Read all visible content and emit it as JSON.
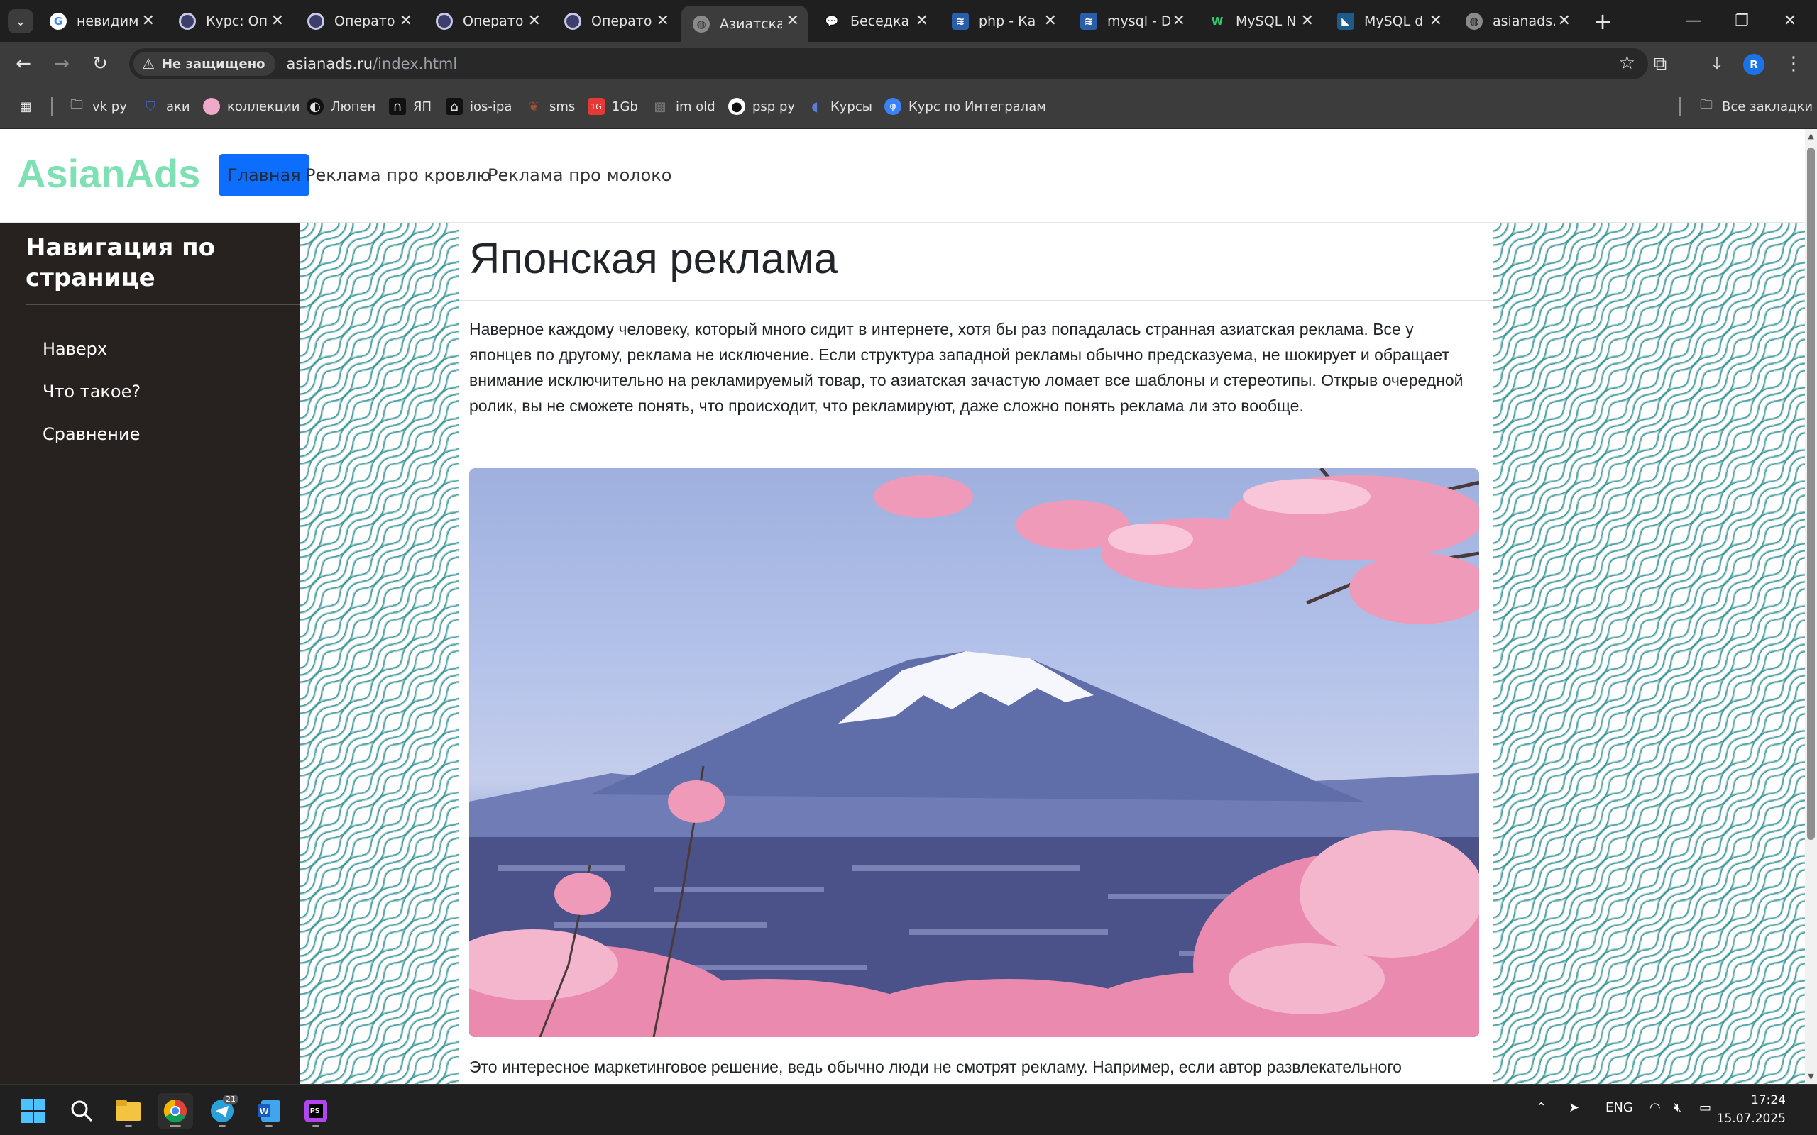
{
  "browser": {
    "tabs": [
      {
        "title": "невидим",
        "favicon": "google-icon",
        "active": false
      },
      {
        "title": "Курс: Опе",
        "favicon": "moodle-icon",
        "active": false
      },
      {
        "title": "Операто",
        "favicon": "moodle-icon",
        "active": false
      },
      {
        "title": "Операто",
        "favicon": "moodle-icon",
        "active": false
      },
      {
        "title": "Операто",
        "favicon": "moodle-icon",
        "active": false
      },
      {
        "title": "Азиатска",
        "favicon": "globe-icon",
        "active": true
      },
      {
        "title": "Беседка",
        "favicon": "chat-icon",
        "active": false
      },
      {
        "title": "php - Ка",
        "favicon": "stackexchange-icon",
        "active": false
      },
      {
        "title": "mysql - D",
        "favicon": "stackexchange-icon",
        "active": false
      },
      {
        "title": "MySQL N",
        "favicon": "w-icon",
        "active": false
      },
      {
        "title": "MySQL d",
        "favicon": "mysql-icon",
        "active": false
      },
      {
        "title": "asianads.",
        "favicon": "globe-icon",
        "active": false
      }
    ],
    "security_label": "Не защищено",
    "url_host": "asianads.ru",
    "url_path": "/index.html",
    "profile_initial": "R",
    "bookmarks": [
      {
        "label": "vk py",
        "icon": "folder-icon"
      },
      {
        "label": "аки",
        "icon": "bag-icon"
      },
      {
        "label": "коллекции",
        "icon": "pink-ball-icon"
      },
      {
        "label": "Люпен",
        "icon": "lupin-icon"
      },
      {
        "label": "ЯП",
        "icon": "arch-icon"
      },
      {
        "label": "ios-ipa",
        "icon": "building-icon"
      },
      {
        "label": "sms",
        "icon": "bird-icon"
      },
      {
        "label": "1Gb",
        "icon": "1gb-icon"
      },
      {
        "label": "im old",
        "icon": "grid-icon"
      },
      {
        "label": "psp py",
        "icon": "github-icon"
      },
      {
        "label": "Курсы",
        "icon": "dot-icon"
      },
      {
        "label": "Курс по Интегралам",
        "icon": "blue-circle-icon"
      }
    ],
    "all_bookmarks": "Все закладки"
  },
  "site": {
    "brand": "AsianAds",
    "nav": [
      {
        "label": "Главная",
        "active": true
      },
      {
        "label": "Реклама про кровлю",
        "active": false
      },
      {
        "label": "Реклама про молоко",
        "active": false
      }
    ],
    "sidebar": {
      "title": "Навигация по странице",
      "links": [
        "Наверх",
        "Что такое?",
        "Сравнение"
      ]
    },
    "heading": "Японская реклама",
    "paragraph": "Наверное каждому человеку, который много сидит в интернете, хотя бы раз попадалась странная азиатская реклама. Все у японцев по другому, реклама не исключение. Если структура западной рекламы обычно предсказуема, не шокирует и обращает внимание исключительно на рекламируемый товар, то азиатская зачастую ломает все шаблоны и стереотипы. Открыв очередной ролик, вы не сможете понять, что происходит, что рекламируют, даже сложно понять реклама ли это вообще.",
    "paragraph2": "Это интересное маркетинговое решение, ведь обычно люди не смотрят рекламу. Например, если автор развлекательного",
    "accent_color": "#7fe0b4",
    "active_nav_color": "#0d6efd"
  },
  "taskbar": {
    "apps": [
      "windows-start-icon",
      "search-icon",
      "file-explorer-icon",
      "chrome-icon",
      "telegram-icon",
      "word-icon",
      "phpstorm-icon"
    ],
    "telegram_badge": "21",
    "language": "ENG",
    "time": "17:24",
    "date": "15.07.2025"
  }
}
